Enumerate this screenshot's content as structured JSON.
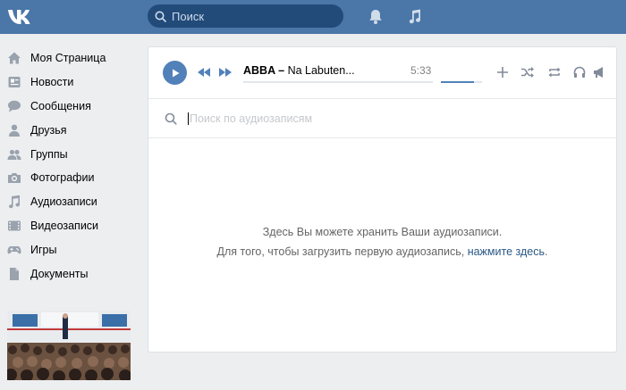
{
  "header": {
    "search_placeholder": "Поиск",
    "icons": [
      "vk-logo-icon",
      "search-icon",
      "bell-icon",
      "music-icon"
    ]
  },
  "sidebar": {
    "items": [
      {
        "label": "Моя Страница",
        "icon": "home-icon"
      },
      {
        "label": "Новости",
        "icon": "news-icon"
      },
      {
        "label": "Сообщения",
        "icon": "messages-icon"
      },
      {
        "label": "Друзья",
        "icon": "friends-icon"
      },
      {
        "label": "Группы",
        "icon": "groups-icon"
      },
      {
        "label": "Фотографии",
        "icon": "camera-icon"
      },
      {
        "label": "Аудиозаписи",
        "icon": "music-note-icon"
      },
      {
        "label": "Видеозаписи",
        "icon": "video-icon"
      },
      {
        "label": "Игры",
        "icon": "gamepad-icon"
      },
      {
        "label": "Документы",
        "icon": "document-icon"
      }
    ]
  },
  "player": {
    "artist": "ABBA",
    "separator": " – ",
    "title": "Na Labuten...",
    "time": "5:33",
    "volume_fraction": 0.8
  },
  "audio_search": {
    "placeholder": "Поиск по аудиозаписям"
  },
  "empty_state": {
    "line1": "Здесь Вы можете хранить Ваши аудиозаписи.",
    "line2_prefix": "Для того, чтобы загрузить первую аудиозапись, ",
    "line2_link": "нажмите здесь",
    "line2_suffix": "."
  },
  "colors": {
    "header": "#4a76a8",
    "accent": "#5181b8",
    "icon_gray": "#99a2ad",
    "link": "#2a5885"
  }
}
